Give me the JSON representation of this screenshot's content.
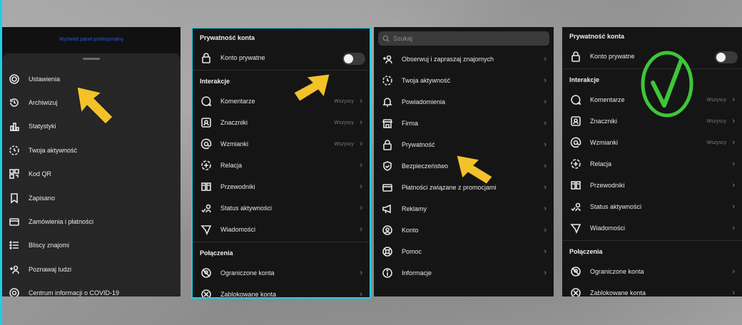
{
  "panel1": {
    "header_text": "Wyświetl panel profesjonalny",
    "items": [
      {
        "icon": "gear-icon",
        "label": "Ustawienia"
      },
      {
        "icon": "archive-icon",
        "label": "Archiwizuj"
      },
      {
        "icon": "stats-icon",
        "label": "Statystyki"
      },
      {
        "icon": "activity-icon",
        "label": "Twoja aktywność"
      },
      {
        "icon": "qr-icon",
        "label": "Kod QR"
      },
      {
        "icon": "bookmark-icon",
        "label": "Zapisano"
      },
      {
        "icon": "card-icon",
        "label": "Zamówienia i płatności"
      },
      {
        "icon": "list-icon",
        "label": "Bliscy znajomi"
      },
      {
        "icon": "add-person-icon",
        "label": "Poznawaj ludzi"
      },
      {
        "icon": "covid-icon",
        "label": "Centrum informacji o COVID-19"
      }
    ]
  },
  "privacy": {
    "section_account": "Prywatność konta",
    "private_label": "Konto prywatne",
    "section_interactions": "Interakcje",
    "items": [
      {
        "icon": "comment-icon",
        "label": "Komentarze",
        "value": "Wszyscy"
      },
      {
        "icon": "tag-icon",
        "label": "Znaczniki",
        "value": "Wszyscy"
      },
      {
        "icon": "mention-icon",
        "label": "Wzmianki",
        "value": "Wszyscy"
      },
      {
        "icon": "story-icon",
        "label": "Relacja",
        "value": ""
      },
      {
        "icon": "guide-icon",
        "label": "Przewodniki",
        "value": ""
      },
      {
        "icon": "status-icon",
        "label": "Status aktywności",
        "value": ""
      },
      {
        "icon": "messages-icon",
        "label": "Wiadomości",
        "value": ""
      }
    ],
    "section_connections": "Połączenia",
    "connections": [
      {
        "icon": "restricted-icon",
        "label": "Ograniczone konta"
      },
      {
        "icon": "blocked-icon",
        "label": "Zablokowane konta"
      }
    ]
  },
  "settings": {
    "search_placeholder": "Szukaj",
    "items": [
      {
        "icon": "follow-icon",
        "label": "Obserwuj i zapraszaj znajomych"
      },
      {
        "icon": "activity-icon",
        "label": "Twoja aktywność"
      },
      {
        "icon": "bell-icon",
        "label": "Powiadomienia"
      },
      {
        "icon": "shop-icon",
        "label": "Firma"
      },
      {
        "icon": "lock-icon",
        "label": "Prywatność"
      },
      {
        "icon": "shield-icon",
        "label": "Bezpieczeństwo"
      },
      {
        "icon": "card-icon",
        "label": "Płatności związane z promocjami"
      },
      {
        "icon": "megaphone-icon",
        "label": "Reklamy"
      },
      {
        "icon": "account-icon",
        "label": "Konto"
      },
      {
        "icon": "help-icon",
        "label": "Pomoc"
      },
      {
        "icon": "info-icon",
        "label": "Informacje"
      }
    ]
  },
  "colors": {
    "highlight": "#19d1e6",
    "arrow": "#f3c229",
    "check": "#3ec63a"
  }
}
